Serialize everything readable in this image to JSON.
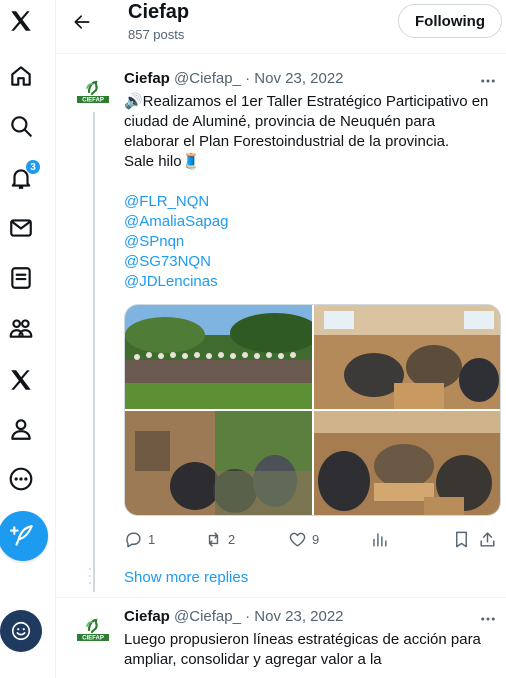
{
  "nav": {
    "items": [
      {
        "name": "x-logo-icon"
      },
      {
        "name": "home-icon"
      },
      {
        "name": "search-icon"
      },
      {
        "name": "notifications-icon",
        "badge": "3"
      },
      {
        "name": "messages-icon"
      },
      {
        "name": "lists-icon"
      },
      {
        "name": "communities-icon"
      },
      {
        "name": "premium-x-icon"
      },
      {
        "name": "profile-icon"
      },
      {
        "name": "more-circle-icon"
      }
    ],
    "compose_icon": "feather-plus-icon",
    "account_icon": "account-avatar"
  },
  "header": {
    "title": "Ciefap",
    "posts_count": "857 posts",
    "follow_button": "Following"
  },
  "tweets": [
    {
      "name": "Ciefap",
      "handle": "@Ciefap_",
      "dot": "·",
      "date": "Nov 23, 2022",
      "text_lines": [
        "🔊Realizamos el 1er Taller Estratégico Participativo en",
        "ciudad de Aluminé, provincia de Neuquén para",
        "elaborar el Plan Forestoindustrial de la provincia.",
        "Sale hilo🧵"
      ],
      "mentions": [
        "@FLR_NQN",
        "@AmaliaSapag",
        "@SPnqn",
        "@SG73NQN",
        "@JDLencinas"
      ],
      "stats": {
        "replies": "1",
        "reposts": "2",
        "likes": "9"
      }
    },
    {
      "name": "Ciefap",
      "handle": "@Ciefap_",
      "dot": "·",
      "date": "Nov 23, 2022",
      "text_lines": [
        "Luego propusieron líneas estratégicas de acción para",
        "ampliar, consolidar y agregar valor a la"
      ]
    }
  ],
  "show_more_replies": "Show more replies",
  "avatar_logo_text": "CIEFAP",
  "colors": {
    "accent": "#1d9bf0",
    "text": "#0f1419",
    "secondary": "#536471",
    "border": "#eff3f4"
  }
}
